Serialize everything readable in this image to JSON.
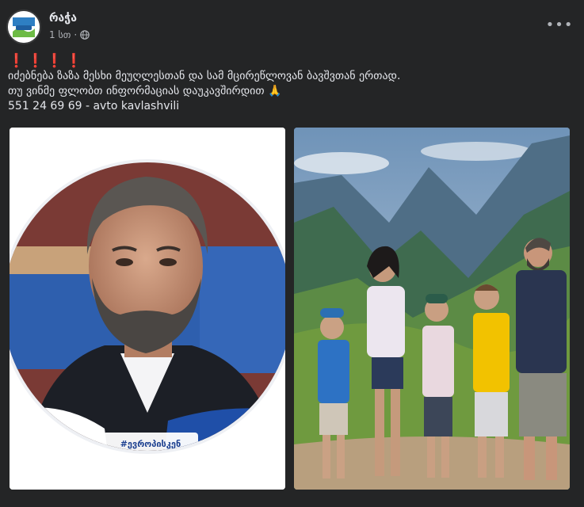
{
  "post": {
    "page_name": "რაჭა",
    "timestamp": "1 სთ",
    "separator": "·",
    "audience_icon": "globe-icon",
    "more_icon": "more-horizontal-icon",
    "more_label": "•••",
    "exclaims": "❗❗❗❗",
    "lines": [
      "იძებნება ზაზა მესხი  მეუღლესთან და სამ მცირეწლოვან ბავშვთან ერთად.",
      "თუ ვინმე ფლობთ ინფორმაციას დაუკავშირდით ",
      "551 24 69 69 - avto kavlashvili"
    ],
    "pray_emoji": "🙏"
  },
  "photo_left": {
    "hashtag": "#ევროპისკენ",
    "subject": "man-portrait"
  },
  "photo_right": {
    "subject": "family-in-mountains"
  },
  "colors": {
    "background": "#242526",
    "text": "#e4e6eb",
    "secondary_text": "#b0b3b8",
    "accent_red": "#e02424"
  }
}
